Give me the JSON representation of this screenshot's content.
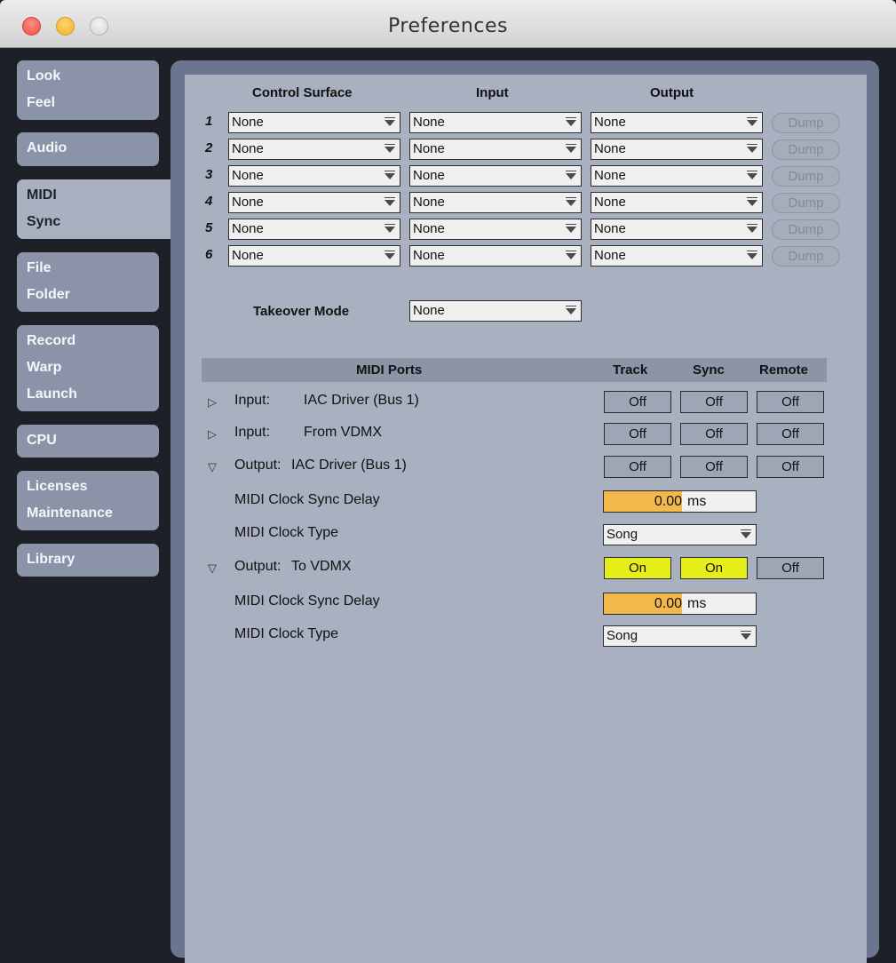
{
  "window": {
    "title": "Preferences",
    "traffic_lights": [
      "close",
      "minimize",
      "zoom"
    ]
  },
  "sidebar": {
    "tabs": [
      {
        "id": "look-feel",
        "lines": [
          "Look",
          "Feel"
        ],
        "active": false
      },
      {
        "id": "audio",
        "lines": [
          "Audio"
        ],
        "active": false
      },
      {
        "id": "midi-sync",
        "lines": [
          "MIDI",
          "Sync"
        ],
        "active": true
      },
      {
        "id": "file-folder",
        "lines": [
          "File",
          "Folder"
        ],
        "active": false
      },
      {
        "id": "record-warp-launch",
        "lines": [
          "Record",
          "Warp",
          "Launch"
        ],
        "active": false
      },
      {
        "id": "cpu",
        "lines": [
          "CPU"
        ],
        "active": false
      },
      {
        "id": "licenses-maintenance",
        "lines": [
          "Licenses",
          "Maintenance"
        ],
        "active": false
      },
      {
        "id": "library",
        "lines": [
          "Library"
        ],
        "active": false
      }
    ]
  },
  "control_surfaces": {
    "headers": {
      "control_surface": "Control Surface",
      "input": "Input",
      "output": "Output"
    },
    "dump_label": "Dump",
    "rows": [
      {
        "num": "1",
        "control_surface": "None",
        "input": "None",
        "output": "None"
      },
      {
        "num": "2",
        "control_surface": "None",
        "input": "None",
        "output": "None"
      },
      {
        "num": "3",
        "control_surface": "None",
        "input": "None",
        "output": "None"
      },
      {
        "num": "4",
        "control_surface": "None",
        "input": "None",
        "output": "None"
      },
      {
        "num": "5",
        "control_surface": "None",
        "input": "None",
        "output": "None"
      },
      {
        "num": "6",
        "control_surface": "None",
        "input": "None",
        "output": "None"
      }
    ]
  },
  "takeover": {
    "label": "Takeover Mode",
    "value": "None"
  },
  "midi_ports": {
    "header": {
      "title": "MIDI Ports",
      "track": "Track",
      "sync": "Sync",
      "remote": "Remote"
    },
    "ports": [
      {
        "direction": "Input:",
        "name": "IAC Driver (Bus 1)",
        "expanded": false,
        "track": "Off",
        "sync": "Off",
        "remote": "Off"
      },
      {
        "direction": "Input:",
        "name": "From VDMX",
        "expanded": false,
        "track": "Off",
        "sync": "Off",
        "remote": "Off"
      },
      {
        "direction": "Output:",
        "name": "IAC Driver (Bus 1)",
        "expanded": true,
        "track": "Off",
        "sync": "Off",
        "remote": "Off",
        "delay_label": "MIDI Clock Sync Delay",
        "delay_value": "0.00",
        "delay_unit": "ms",
        "clock_type_label": "MIDI Clock Type",
        "clock_type": "Song"
      },
      {
        "direction": "Output:",
        "name": "To VDMX",
        "expanded": true,
        "track": "On",
        "sync": "On",
        "remote": "Off",
        "delay_label": "MIDI Clock Sync Delay",
        "delay_value": "0.00",
        "delay_unit": "ms",
        "clock_type_label": "MIDI Clock Type",
        "clock_type": "Song"
      }
    ]
  },
  "colors": {
    "on_button": "#e7ef1b",
    "delay_slider": "#f2b84b",
    "panel_background": "#a9b0bf",
    "sidebar_tab": "#8a93a8",
    "window_background": "#1d2127"
  }
}
